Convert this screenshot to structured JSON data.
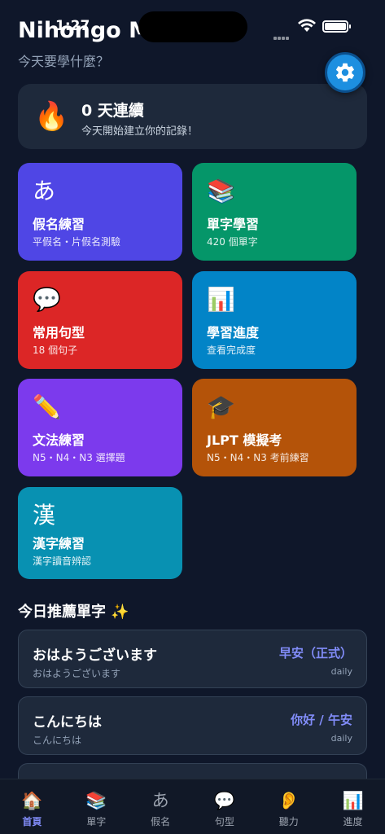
{
  "status_bar": {
    "time": "1:27"
  },
  "header": {
    "title": "Nihongo M",
    "subtitle": "今天要學什麼？",
    "settings_icon": "gear-icon"
  },
  "streak": {
    "icon": "🔥",
    "title": "0 天連續",
    "subtitle": "今天開始建立你的記錄！"
  },
  "tiles": [
    {
      "icon": "あ",
      "title": "假名練習",
      "subtitle": "平假名・片假名測驗",
      "color": "#4f46e5"
    },
    {
      "icon": "📚",
      "title": "單字學習",
      "subtitle": "420 個單字",
      "color": "#059669"
    },
    {
      "icon": "💬",
      "title": "常用句型",
      "subtitle": "18 個句子",
      "color": "#dc2626"
    },
    {
      "icon": "📊",
      "title": "學習進度",
      "subtitle": "查看完成度",
      "color": "#0284c7"
    },
    {
      "icon": "✏️",
      "title": "文法練習",
      "subtitle": "N5・N4・N3 選擇題",
      "color": "#7c3aed"
    },
    {
      "icon": "🎓",
      "title": "JLPT 模擬考",
      "subtitle": "N5・N4・N3 考前練習",
      "color": "#b45309"
    },
    {
      "icon": "漢",
      "title": "漢字練習",
      "subtitle": "漢字讀音辨認",
      "color": "#0891b2"
    }
  ],
  "recommended": {
    "title": "今日推薦單字 ✨",
    "words": [
      {
        "jp": "おはようございます",
        "kana": "おはようございます",
        "meaning": "早安（正式）",
        "tag": "daily"
      },
      {
        "jp": "こんにちは",
        "kana": "こんにちは",
        "meaning": "你好 / 午安",
        "tag": "daily"
      }
    ]
  },
  "nav": [
    {
      "icon": "🏠",
      "label": "首頁"
    },
    {
      "icon": "📚",
      "label": "單字"
    },
    {
      "icon": "あ",
      "label": "假名"
    },
    {
      "icon": "💬",
      "label": "句型"
    },
    {
      "icon": "👂",
      "label": "聽力"
    },
    {
      "icon": "📊",
      "label": "進度"
    }
  ],
  "colors": {
    "background": "#0f172a",
    "card": "#1e293b",
    "accent": "#818cf8",
    "settings": "#1d8fe0"
  }
}
